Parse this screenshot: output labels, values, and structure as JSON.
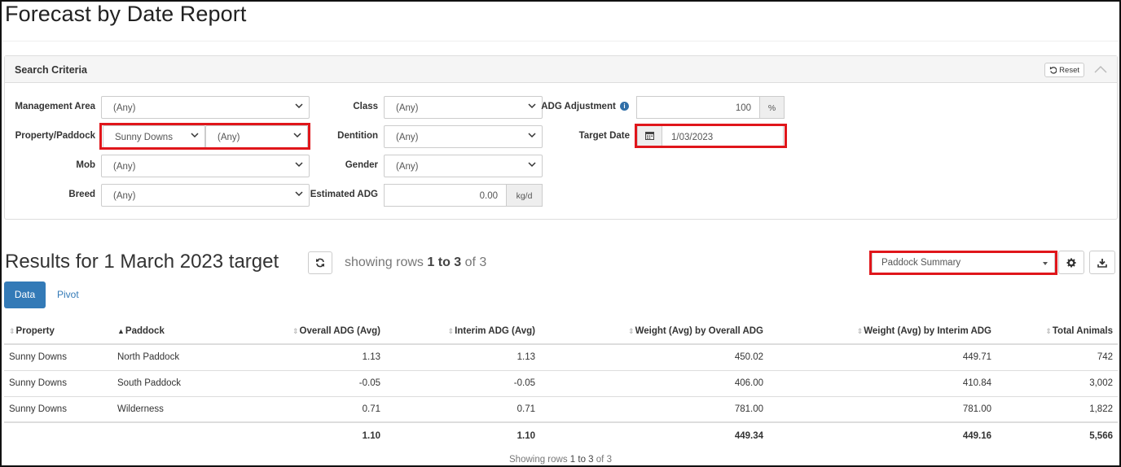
{
  "page": {
    "title": "Forecast by Date Report"
  },
  "search": {
    "title": "Search Criteria",
    "reset_label": "Reset",
    "fields": {
      "management_area": {
        "label": "Management Area",
        "value": "(Any)"
      },
      "property_paddock": {
        "label": "Property/Paddock",
        "property_value": "Sunny Downs",
        "paddock_value": "(Any)"
      },
      "mob": {
        "label": "Mob",
        "value": "(Any)"
      },
      "breed": {
        "label": "Breed",
        "value": "(Any)"
      },
      "class": {
        "label": "Class",
        "value": "(Any)"
      },
      "dentition": {
        "label": "Dentition",
        "value": "(Any)"
      },
      "gender": {
        "label": "Gender",
        "value": "(Any)"
      },
      "estimated_adg": {
        "label": "Estimated ADG",
        "value": "0.00",
        "unit": "kg/d"
      },
      "adg_adjustment": {
        "label": "ADG Adjustment",
        "value": "100",
        "unit": "%"
      },
      "target_date": {
        "label": "Target Date",
        "value": "1/03/2023"
      }
    }
  },
  "results": {
    "title": "Results for 1 March 2023 target",
    "showing_prefix": "showing rows",
    "showing_range": "1 to 3",
    "showing_suffix": "of 3",
    "view_select": "Paddock Summary",
    "tabs": {
      "data": "Data",
      "pivot": "Pivot"
    },
    "columns": [
      "Property",
      "Paddock",
      "Overall ADG (Avg)",
      "Interim ADG (Avg)",
      "Weight (Avg) by Overall ADG",
      "Weight (Avg) by Interim ADG",
      "Total Animals"
    ],
    "rows": [
      [
        "Sunny Downs",
        "North Paddock",
        "1.13",
        "1.13",
        "450.02",
        "449.71",
        "742"
      ],
      [
        "Sunny Downs",
        "South Paddock",
        "-0.05",
        "-0.05",
        "406.00",
        "410.84",
        "3,002"
      ],
      [
        "Sunny Downs",
        "Wilderness",
        "0.71",
        "0.71",
        "781.00",
        "781.00",
        "1,822"
      ]
    ],
    "totals": [
      "",
      "",
      "1.10",
      "1.10",
      "449.34",
      "449.16",
      "5,566"
    ],
    "footer_prefix": "Showing rows",
    "footer_range": "1 to 3",
    "footer_suffix": "of 3"
  },
  "colors": {
    "highlight": "#e0161b",
    "primary": "#337ab7"
  }
}
